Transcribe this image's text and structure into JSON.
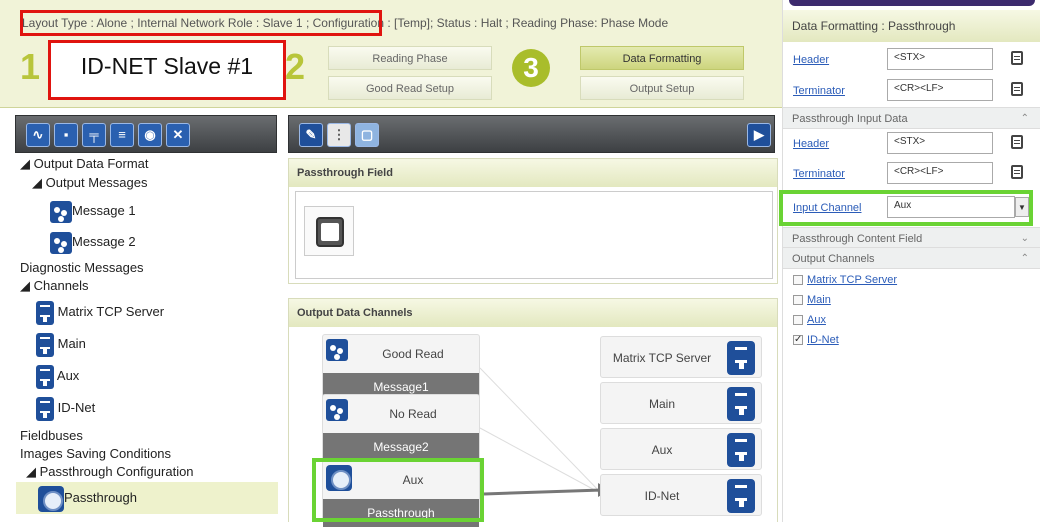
{
  "header": {
    "status_line": "Layout Type :  Alone ;  Internal Network Role :  Slave 1 ;  Configuration : [Temp];  Status :  Halt ;  Reading Phase:  Phase Mode",
    "title": "ID-NET Slave #1",
    "step1": "1",
    "step2": "2",
    "step3": "3",
    "buttons": {
      "reading_phase": "Reading Phase",
      "good_read_setup": "Good Read Setup",
      "data_formatting": "Data Formatting",
      "output_setup": "Output Setup"
    }
  },
  "left_toolbar": {
    "icons": [
      "waveform-icon",
      "camera-icon",
      "plug-icon",
      "document-icon",
      "disc-icon",
      "close-icon"
    ]
  },
  "tree": {
    "output_data_format": "Output Data Format",
    "output_messages": "Output Messages",
    "message1": "Message 1",
    "message2": "Message 2",
    "diagnostic_messages": "Diagnostic Messages",
    "channels": "Channels",
    "matrix_tcp_server": "Matrix TCP Server",
    "main": "Main",
    "aux": "Aux",
    "idnet": "ID-Net",
    "fieldbuses": "Fieldbuses",
    "images_saving": "Images Saving Conditions",
    "passthrough_config": "Passthrough Configuration",
    "passthrough": "Passthrough"
  },
  "center": {
    "passthrough_field": "Passthrough Field",
    "output_data_channels": "Output Data Channels",
    "sources": [
      {
        "top": "Good Read",
        "bottom": "Message1"
      },
      {
        "top": "No Read",
        "bottom": "Message2"
      },
      {
        "top": "Aux",
        "bottom": "Passthrough"
      }
    ],
    "outputs": [
      "Matrix TCP Server",
      "Main",
      "Aux",
      "ID-Net"
    ]
  },
  "right": {
    "title": "Data Formatting :  Passthrough",
    "header_label": "Header",
    "header_value": "<STX>",
    "terminator_label": "Terminator",
    "terminator_value": "<CR><LF>",
    "passthrough_input_data": "Passthrough Input Data",
    "input_header_label": "Header",
    "input_header_value": "<STX>",
    "input_terminator_label": "Terminator",
    "input_terminator_value": "<CR><LF>",
    "input_channel_label": "Input Channel",
    "input_channel_value": "Aux",
    "content_field": "Passthrough Content Field",
    "output_channels": "Output Channels",
    "channels": [
      {
        "label": "Matrix TCP Server",
        "checked": false
      },
      {
        "label": "Main",
        "checked": false
      },
      {
        "label": "Aux",
        "checked": false
      },
      {
        "label": "ID-Net",
        "checked": true
      }
    ]
  },
  "colors": {
    "accent": "#b8c53a",
    "highlight_red": "#e0140f",
    "highlight_green": "#6ad334",
    "icon_blue": "#1f4f9a"
  }
}
